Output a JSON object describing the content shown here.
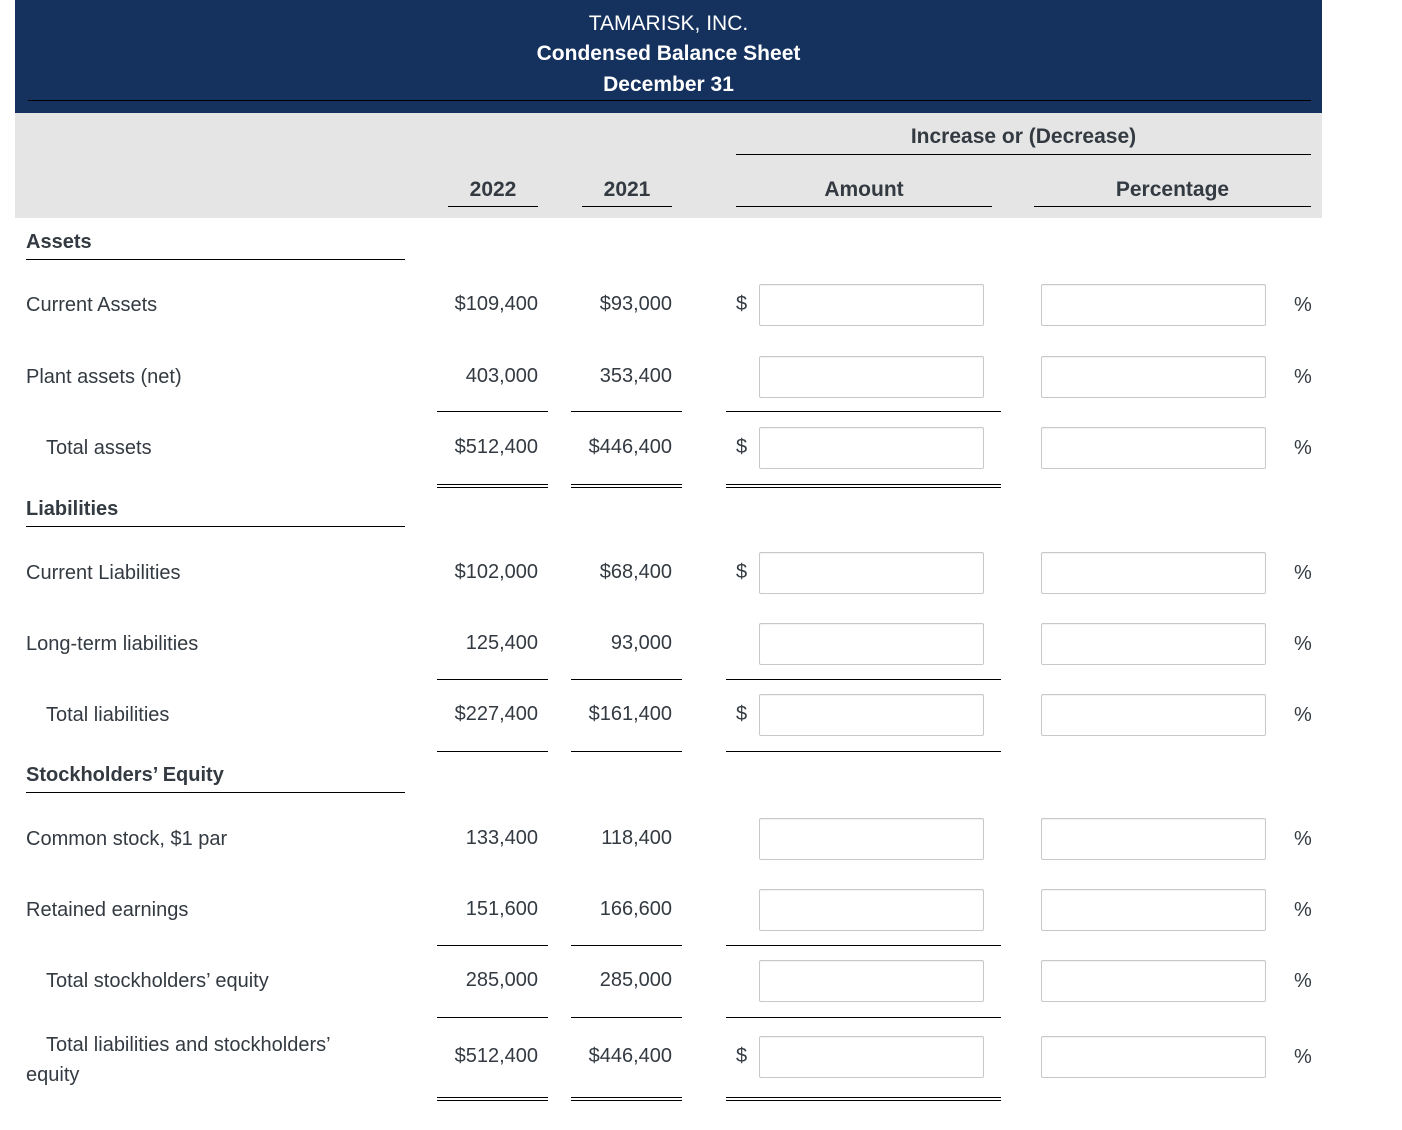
{
  "header": {
    "company": "TAMARISK, INC.",
    "statement": "Condensed Balance Sheet",
    "date": "December 31"
  },
  "columns": {
    "increase_group": "Increase or (Decrease)",
    "year1": "2022",
    "year2": "2021",
    "amount": "Amount",
    "percentage": "Percentage"
  },
  "symbols": {
    "dollar": "$",
    "percent": "%"
  },
  "sections": {
    "assets": "Assets",
    "liabilities": "Liabilities",
    "equity": "Stockholders’ Equity"
  },
  "rows": [
    {
      "label": "Current Assets",
      "y2022": "$109,400",
      "y2021": "$93,000",
      "amount_value": "",
      "percentage_value": "",
      "dollar": "$",
      "percent": "%"
    },
    {
      "label": "Plant assets (net)",
      "y2022": "403,000",
      "y2021": "353,400",
      "amount_value": "",
      "percentage_value": "",
      "dollar": "",
      "percent": "%"
    },
    {
      "label": "Total assets",
      "y2022": "$512,400",
      "y2021": "$446,400",
      "amount_value": "",
      "percentage_value": "",
      "dollar": "$",
      "percent": "%"
    },
    {
      "label": "Current Liabilities",
      "y2022": "$102,000",
      "y2021": "$68,400",
      "amount_value": "",
      "percentage_value": "",
      "dollar": "$",
      "percent": "%"
    },
    {
      "label": "Long-term liabilities",
      "y2022": "125,400",
      "y2021": "93,000",
      "amount_value": "",
      "percentage_value": "",
      "dollar": "",
      "percent": "%"
    },
    {
      "label": "Total liabilities",
      "y2022": "$227,400",
      "y2021": "$161,400",
      "amount_value": "",
      "percentage_value": "",
      "dollar": "$",
      "percent": "%"
    },
    {
      "label": "Common stock, $1 par",
      "y2022": "133,400",
      "y2021": "118,400",
      "amount_value": "",
      "percentage_value": "",
      "dollar": "",
      "percent": "%"
    },
    {
      "label": "Retained earnings",
      "y2022": "151,600",
      "y2021": "166,600",
      "amount_value": "",
      "percentage_value": "",
      "dollar": "",
      "percent": "%"
    },
    {
      "label": "Total stockholders’ equity",
      "y2022": "285,000",
      "y2021": "285,000",
      "amount_value": "",
      "percentage_value": "",
      "dollar": "",
      "percent": "%"
    },
    {
      "label": "Total liabilities and stockholders’ equity",
      "y2022": "$512,400",
      "y2021": "$446,400",
      "amount_value": "",
      "percentage_value": "",
      "dollar": "$",
      "percent": "%"
    }
  ]
}
